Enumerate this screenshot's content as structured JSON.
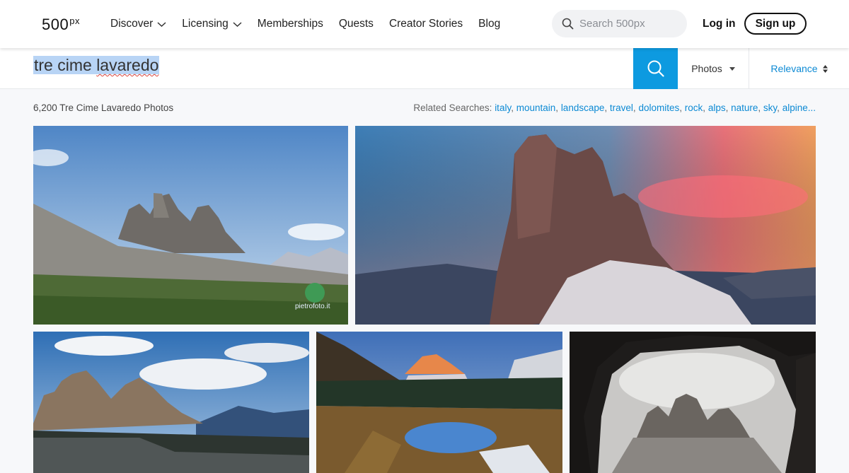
{
  "nav": {
    "logo_main": "500",
    "logo_px": "px",
    "links": [
      {
        "label": "Discover",
        "has_dropdown": true
      },
      {
        "label": "Licensing",
        "has_dropdown": true
      },
      {
        "label": "Memberships",
        "has_dropdown": false
      },
      {
        "label": "Quests",
        "has_dropdown": false
      },
      {
        "label": "Creator Stories",
        "has_dropdown": false
      },
      {
        "label": "Blog",
        "has_dropdown": false
      }
    ],
    "search_placeholder": "Search 500px",
    "login_label": "Log in",
    "signup_label": "Sign up"
  },
  "search": {
    "query": "tre cime lavaredo",
    "type_filter": "Photos",
    "sort": "Relevance",
    "accent_color": "#0d9ae0"
  },
  "results": {
    "count_text": "6,200 Tre Cime Lavaredo Photos",
    "related_label": "Related Searches:",
    "related_terms": [
      "italy",
      "mountain",
      "landscape",
      "travel",
      "dolomites",
      "rock",
      "alps",
      "nature",
      "sky",
      "alpine..."
    ]
  },
  "photos": [
    {
      "watermark": "pietrofoto.it"
    },
    {},
    {},
    {},
    {}
  ]
}
